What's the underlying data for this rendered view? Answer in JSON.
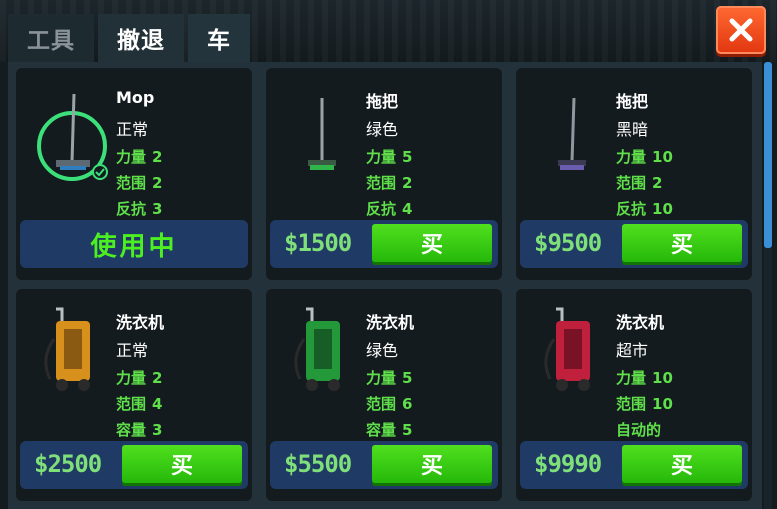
{
  "tabs": [
    {
      "label": "工具"
    },
    {
      "label": "撤退"
    },
    {
      "label": "车"
    }
  ],
  "close_label": "✕",
  "colors": {
    "stat_green": "#5fe04a",
    "price_green": "#7fe07a",
    "buy_button": "#37c814",
    "bar_blue": "#203a66",
    "close_orange": "#f04c1c",
    "scroll_blue": "#3a8fd6"
  },
  "items": [
    {
      "name": "Mop",
      "variant": "正常",
      "stats": [
        {
          "label": "力量",
          "value": "2"
        },
        {
          "label": "范围",
          "value": "2"
        },
        {
          "label": "反抗",
          "value": "3"
        }
      ],
      "status": "使用中",
      "icon": "mop-gray-icon",
      "selected": true
    },
    {
      "name": "拖把",
      "variant": "绿色",
      "stats": [
        {
          "label": "力量",
          "value": "5"
        },
        {
          "label": "范围",
          "value": "2"
        },
        {
          "label": "反抗",
          "value": "4"
        }
      ],
      "price": "$1500",
      "buy_label": "买",
      "icon": "mop-green-icon"
    },
    {
      "name": "拖把",
      "variant": "黑暗",
      "stats": [
        {
          "label": "力量",
          "value": "10"
        },
        {
          "label": "范围",
          "value": "2"
        },
        {
          "label": "反抗",
          "value": "10"
        }
      ],
      "price": "$9500",
      "buy_label": "买",
      "icon": "mop-dark-icon"
    },
    {
      "name": "洗衣机",
      "variant": "正常",
      "stats": [
        {
          "label": "力量",
          "value": "2"
        },
        {
          "label": "范围",
          "value": "4"
        },
        {
          "label": "容量",
          "value": "3"
        }
      ],
      "price": "$2500",
      "buy_label": "买",
      "icon": "pressure-washer-orange-icon"
    },
    {
      "name": "洗衣机",
      "variant": "绿色",
      "stats": [
        {
          "label": "力量",
          "value": "5"
        },
        {
          "label": "范围",
          "value": "6"
        },
        {
          "label": "容量",
          "value": "5"
        }
      ],
      "price": "$5500",
      "buy_label": "买",
      "icon": "pressure-washer-green-icon"
    },
    {
      "name": "洗衣机",
      "variant": "超市",
      "stats": [
        {
          "label": "力量",
          "value": "10"
        },
        {
          "label": "范围",
          "value": "10"
        },
        {
          "label": "自动的",
          "value": ""
        }
      ],
      "price": "$9990",
      "buy_label": "买",
      "icon": "pressure-washer-red-icon"
    }
  ]
}
